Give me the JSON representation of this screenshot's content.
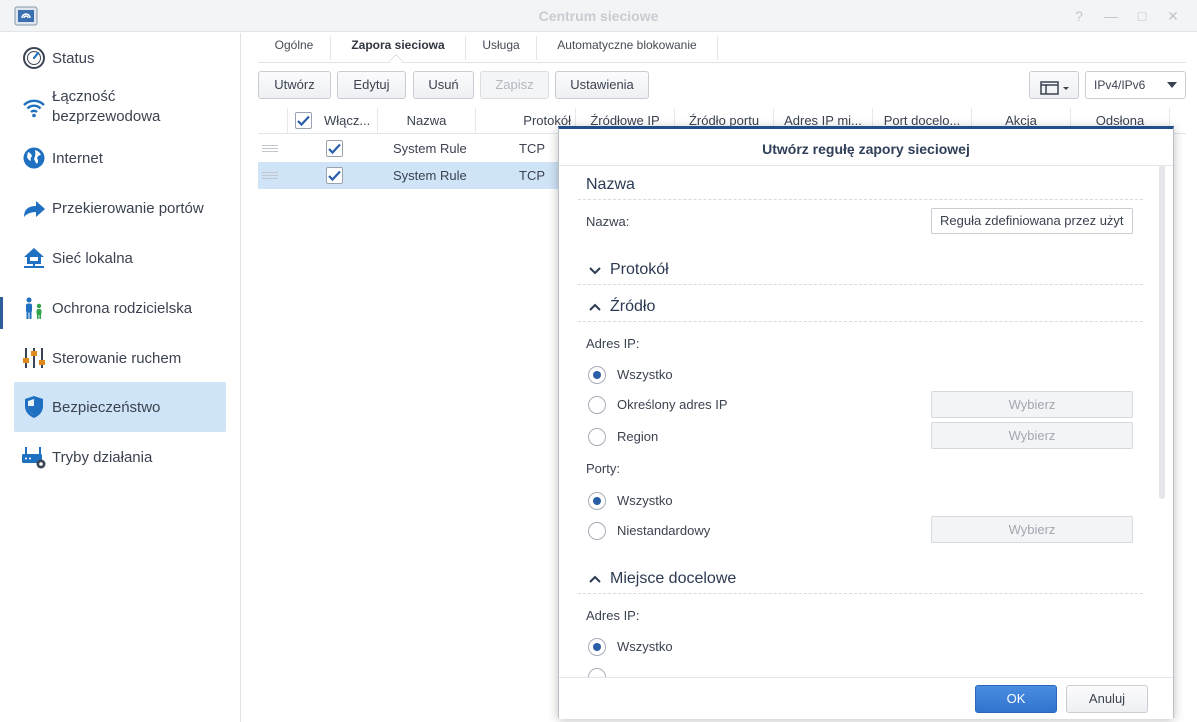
{
  "window": {
    "title": "Centrum sieciowe",
    "controls": [
      "?",
      "—",
      "□",
      "✕"
    ]
  },
  "sidebar": {
    "items": [
      {
        "label": "Status",
        "icon": "gauge-icon"
      },
      {
        "label_line1": "Łączność",
        "label_line2": "bezprzewodowa",
        "icon": "wifi-icon"
      },
      {
        "label": "Internet",
        "icon": "globe-icon"
      },
      {
        "label": "Przekierowanie portów",
        "icon": "forward-arrow-icon"
      },
      {
        "label": "Sieć lokalna",
        "icon": "home-network-icon"
      },
      {
        "label": "Ochrona rodzicielska",
        "icon": "family-icon"
      },
      {
        "label": "Sterowanie ruchem",
        "icon": "sliders-icon"
      },
      {
        "label": "Bezpieczeństwo",
        "icon": "shield-icon",
        "active": true
      },
      {
        "label": "Tryby działania",
        "icon": "router-gear-icon"
      }
    ]
  },
  "tabs": [
    "Ogólne",
    "Zapora sieciowa",
    "Usługa",
    "Automatyczne blokowanie"
  ],
  "toolbar": {
    "create": "Utwórz",
    "edit": "Edytuj",
    "delete": "Usuń",
    "save": "Zapisz",
    "settings": "Ustawienia",
    "ip_version": "IPv4/IPv6"
  },
  "table": {
    "columns": [
      "Włącz...",
      "Nazwa",
      "Protokół",
      "Źródłowe IP",
      "Źródło portu",
      "Adres IP mi...",
      "Port docelo...",
      "Akcja",
      "Odsłona"
    ],
    "rows": [
      {
        "enabled": true,
        "name": "System Rule",
        "protocol": "TCP",
        "selected": false
      },
      {
        "enabled": true,
        "name": "System Rule",
        "protocol": "TCP",
        "selected": true
      }
    ]
  },
  "dialog": {
    "title": "Utwórz regułę zapory sieciowej",
    "name_section": "Nazwa",
    "name_label": "Nazwa:",
    "name_value": "Reguła zdefiniowana przez użyt",
    "protocol_section": "Protokół",
    "source_section": "Źródło",
    "source_ip_label": "Adres IP:",
    "source_ip_options": [
      "Wszystko",
      "Określony adres IP",
      "Region"
    ],
    "ports_label": "Porty:",
    "ports_options": [
      "Wszystko",
      "Niestandardowy"
    ],
    "choose": "Wybierz",
    "destination_section": "Miejsce docelowe",
    "dest_ip_label": "Adres IP:",
    "dest_ip_options": [
      "Wszystko"
    ],
    "ok": "OK",
    "cancel": "Anuluj"
  },
  "colors": {
    "accent": "#2f74cf",
    "active_bg": "#cfe4f7",
    "icon_blue": "#1f70c1"
  }
}
